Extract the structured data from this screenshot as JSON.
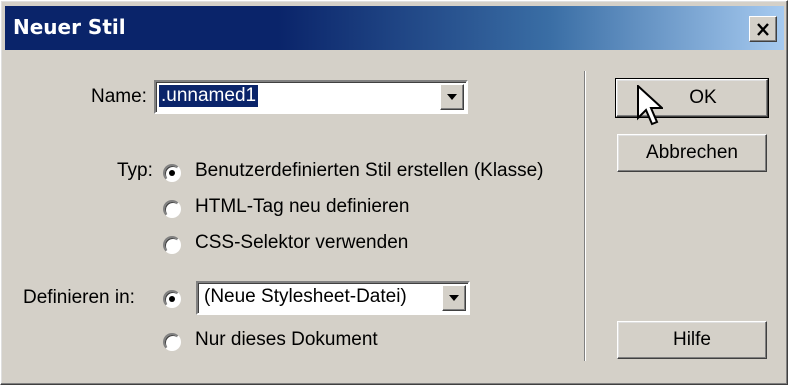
{
  "window": {
    "title": "Neuer Stil",
    "close_glyph": "✕"
  },
  "form": {
    "name_label": "Name:",
    "name_value": ".unnamed1",
    "type_label": "Typ:",
    "type_options": [
      {
        "label": "Benutzerdefinierten Stil erstellen (Klasse)",
        "selected": true
      },
      {
        "label": "HTML-Tag neu definieren",
        "selected": false
      },
      {
        "label": "CSS-Selektor verwenden",
        "selected": false
      }
    ],
    "define_label": "Definieren in:",
    "define_options": [
      {
        "label": "(Neue Stylesheet-Datei)",
        "selected": true,
        "is_select": true
      },
      {
        "label": "Nur dieses Dokument",
        "selected": false
      }
    ]
  },
  "buttons": {
    "ok": "OK",
    "cancel": "Abbrechen",
    "help": "Hilfe"
  },
  "icons": {
    "dropdown": "chevron-down-icon",
    "cursor": "arrow-cursor-icon"
  }
}
